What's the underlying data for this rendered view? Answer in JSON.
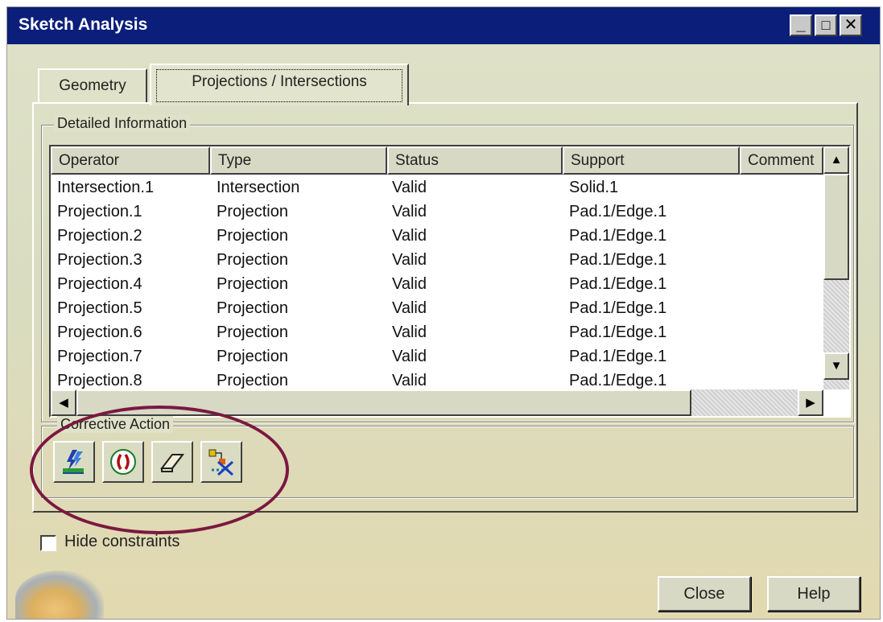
{
  "window": {
    "title": "Sketch Analysis",
    "controls": {
      "minimize": "_",
      "maximize": "□",
      "close": "✕"
    }
  },
  "tabs": [
    {
      "label": "Geometry",
      "active": false
    },
    {
      "label": "Projections / Intersections",
      "active": true
    }
  ],
  "detailed_info": {
    "label": "Detailed Information",
    "columns": [
      "Operator",
      "Type",
      "Status",
      "Support",
      "Comment"
    ],
    "rows": [
      [
        "Intersection.1",
        "Intersection",
        "Valid",
        "Solid.1",
        ""
      ],
      [
        "Projection.1",
        "Projection",
        "Valid",
        "Pad.1/Edge.1",
        ""
      ],
      [
        "Projection.2",
        "Projection",
        "Valid",
        "Pad.1/Edge.1",
        ""
      ],
      [
        "Projection.3",
        "Projection",
        "Valid",
        "Pad.1/Edge.1",
        ""
      ],
      [
        "Projection.4",
        "Projection",
        "Valid",
        "Pad.1/Edge.1",
        ""
      ],
      [
        "Projection.5",
        "Projection",
        "Valid",
        "Pad.1/Edge.1",
        ""
      ],
      [
        "Projection.6",
        "Projection",
        "Valid",
        "Pad.1/Edge.1",
        ""
      ],
      [
        "Projection.7",
        "Projection",
        "Valid",
        "Pad.1/Edge.1",
        ""
      ],
      [
        "Projection.8",
        "Projection",
        "Valid",
        "Pad.1/Edge.1",
        ""
      ]
    ],
    "scroll_up": "▲",
    "scroll_down": "▼",
    "scroll_left": "◀",
    "scroll_right": "▶"
  },
  "corrective_action": {
    "label": "Corrective Action",
    "buttons": [
      {
        "icon": "isolate-icon"
      },
      {
        "icon": "construction-icon"
      },
      {
        "icon": "erase-icon"
      },
      {
        "icon": "hide-icon"
      }
    ]
  },
  "hide_constraints": {
    "label": "Hide constraints",
    "checked": false
  },
  "buttons": {
    "close": "Close",
    "help": "Help"
  },
  "colors": {
    "titlebar": "#0b1e7a",
    "highlight_circle": "#7b1840",
    "dialog_bg": "#dfe2c8"
  }
}
